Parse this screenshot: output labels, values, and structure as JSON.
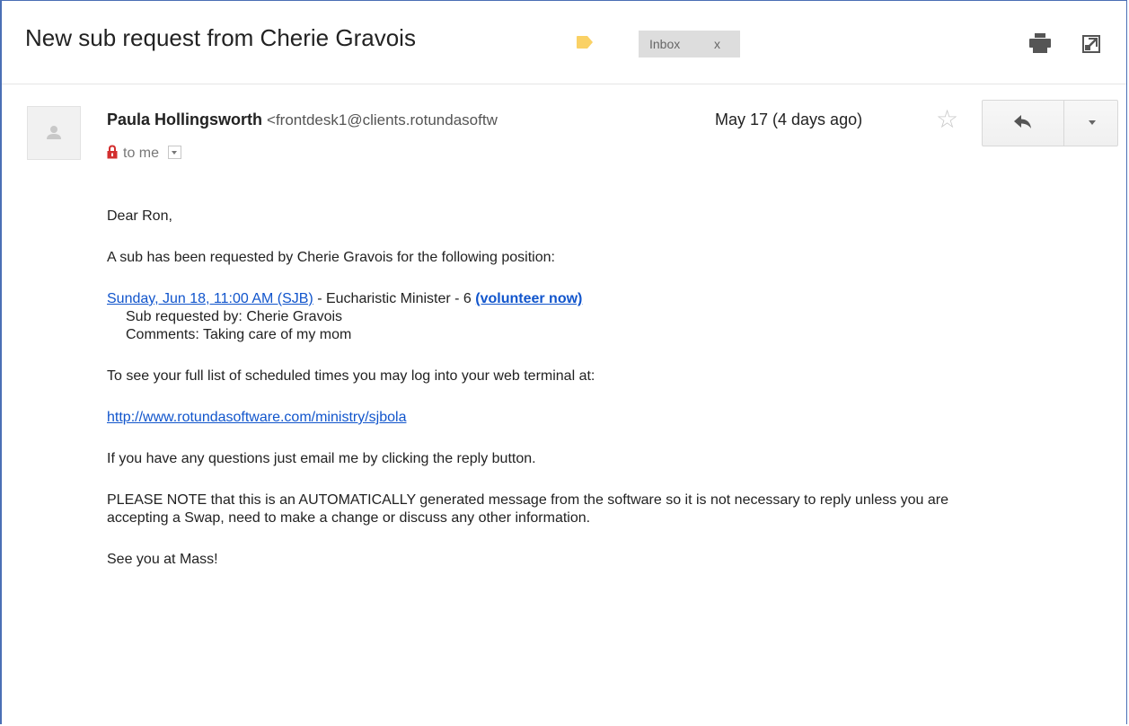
{
  "subject": "New sub request from Cherie Gravois",
  "labels": {
    "inbox": "Inbox",
    "remove": "x"
  },
  "colors": {
    "label_tag": "#fad165",
    "link": "#1155cc",
    "frame_border": "#4a6fb5"
  },
  "message": {
    "sender_name": "Paula Hollingsworth",
    "sender_email": "<frontdesk1@clients.rotundasoftw",
    "recipient": "to me",
    "date": "May 17 (4 days ago)",
    "body": {
      "greeting": "Dear Ron,",
      "intro": "A sub has been requested by Cherie Gravois for the following position:",
      "position_link": "Sunday, Jun 18, 11:00 AM (SJB)",
      "position_detail": " - Eucharistic Minister - 6 ",
      "volunteer_link": "(volunteer now)",
      "sub_requested_by": "Sub requested by: Cherie Gravois",
      "comments": "Comments: Taking care of my mom",
      "see_list": "To see your full list of scheduled times you may log into your web terminal at:",
      "terminal_link": "http://www.rotundasoftware.com/ministry/sjbola",
      "questions": "If you have any questions just email me by clicking the reply button.",
      "note": "PLEASE NOTE that this is an AUTOMATICALLY generated message from the software so it is not necessary to reply unless you are accepting a Swap, need to make a change or discuss any other information.",
      "signoff": "See you at Mass!"
    }
  },
  "icons": {
    "label": "label-tag-icon",
    "print": "print-icon",
    "new_window": "new-window-icon",
    "avatar": "default-avatar-icon",
    "lock": "lock-icon",
    "star": "star-icon",
    "reply": "reply-icon",
    "more": "chevron-down-icon"
  }
}
